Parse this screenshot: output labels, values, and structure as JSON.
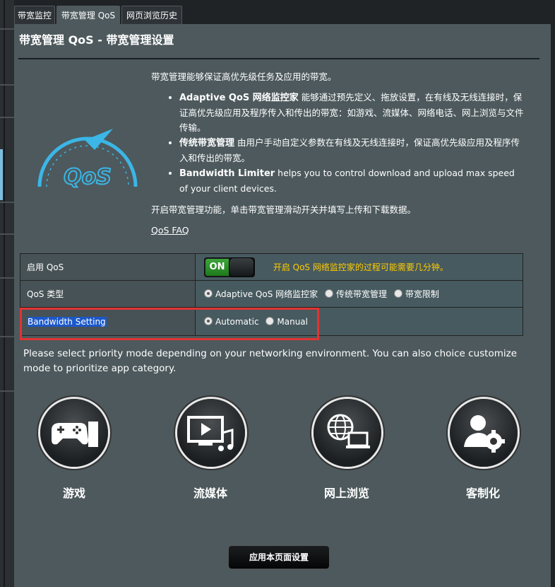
{
  "tabs": [
    {
      "label": "带宽监控"
    },
    {
      "label": "带宽管理 QoS"
    },
    {
      "label": "网页浏览历史"
    }
  ],
  "panel_title": "带宽管理 QoS - 带宽管理设置",
  "logo_text": "QoS",
  "intro": {
    "lead": "带宽管理能够保证高优先级任务及应用的带宽。",
    "bullets": [
      {
        "bold": "Adaptive QoS 网络监控家",
        "text": " 能够通过预先定义、拖放设置，在有线及无线连接时，保证高优先级应用及程序传入和传出的带宽：如游戏、流媒体、网络电话、网上浏览与文件传输。"
      },
      {
        "bold": "传统带宽管理",
        "text": " 由用户手动自定义参数在有线及无线连接时，保证高优先级应用及程序传入和传出的带宽。"
      },
      {
        "bold": "Bandwidth Limiter",
        "text": " helps you to control download and upload max speed of your client devices."
      }
    ],
    "enable_note": "开启带宽管理功能，单击带宽管理滑动开关并填写上传和下载数据。",
    "faq": "QoS FAQ"
  },
  "settings": {
    "enable_label": "启用 QoS",
    "toggle_on": "ON",
    "toggle_note": "开启 QoS 网络监控家的过程可能需要几分钟。",
    "type_label": "QoS 类型",
    "type_options": [
      "Adaptive QoS 网络监控家",
      "传统带宽管理",
      "带宽限制"
    ],
    "bw_label": "Bandwidth Setting",
    "bw_options": [
      "Automatic",
      "Manual"
    ]
  },
  "description": "Please select priority mode depending on your networking environment. You can also choice customize mode to prioritize app category.",
  "modes": [
    {
      "label": "游戏",
      "icon": "gamepad-icon"
    },
    {
      "label": "流媒体",
      "icon": "media-streaming-icon"
    },
    {
      "label": "网上浏览",
      "icon": "web-browsing-icon"
    },
    {
      "label": "客制化",
      "icon": "customize-icon"
    }
  ],
  "apply_button": "应用本页面设置",
  "colors": {
    "panel": "#4d595d",
    "note": "#ffcc00",
    "toggle_on": "#3da53a",
    "highlight": "#e03434",
    "logo": "#3bb6e6"
  }
}
